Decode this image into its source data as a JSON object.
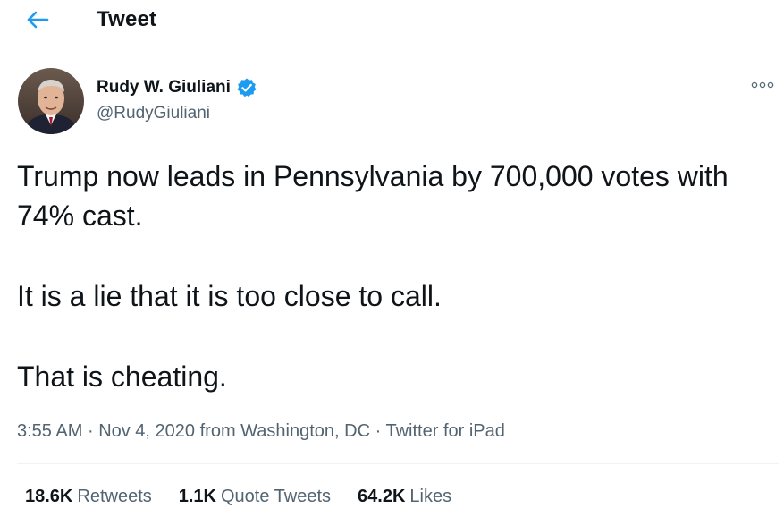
{
  "header": {
    "title": "Tweet",
    "back_icon": "arrow-left-icon",
    "accent_color": "#1d9bf0"
  },
  "author": {
    "name": "Rudy W. Giuliani",
    "handle": "@RudyGiuliani",
    "verified": true,
    "verified_icon": "verified-badge-icon"
  },
  "tweet": {
    "paragraphs": [
      "Trump now leads in Pennsylvania by 700,000 votes with 74% cast.",
      "It is a lie that it is too close to call.",
      "That is cheating."
    ],
    "time": "3:55 AM",
    "date": "Nov 4, 2020",
    "location": "from Washington, DC",
    "source": "Twitter for iPad",
    "separator": "·"
  },
  "stats": {
    "retweets_count": "18.6K",
    "retweets_label": "Retweets",
    "quotes_count": "1.1K",
    "quotes_label": "Quote Tweets",
    "likes_count": "64.2K",
    "likes_label": "Likes"
  },
  "more_icon": "more-options-icon"
}
